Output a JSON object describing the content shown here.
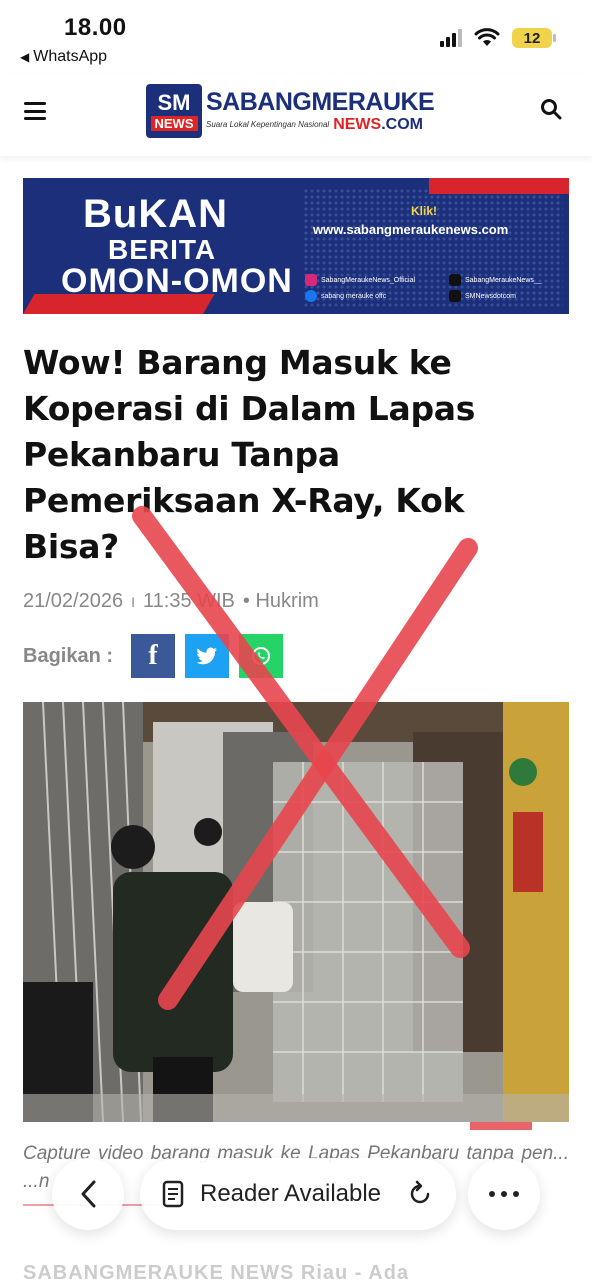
{
  "status_bar": {
    "time": "18.00",
    "back_app": "WhatsApp",
    "battery": "12"
  },
  "header": {
    "logo": {
      "badge_top": "SM",
      "badge_bottom": "NEWS",
      "name": "SABANGMERAUKE",
      "tagline": "Suara Lokal Kepentingan Nasional",
      "domain_part1": "NEWS",
      "domain_part2": ".COM"
    },
    "menu_icon": "hamburger-icon",
    "search_icon": "search-icon"
  },
  "banner": {
    "line1": "BuKAN",
    "line2": "BERITA",
    "line3": "OMON-OMON",
    "klik": "Klik!",
    "url": "www.sabangmeraukenews.com",
    "instagram": "SabangMeraukeNews_Official",
    "tiktok": "SabangMeraukeNews__",
    "facebook": "sabang merauke offc",
    "x": "SMNewsdotcom"
  },
  "article": {
    "headline": "Wow! Barang Masuk ke Koperasi di Dalam Lapas Pekanbaru Tanpa Pemeriksaan X-Ray, Kok Bisa?",
    "date": "21/02/2026",
    "separator": "I",
    "time": "11:35 WIB",
    "category": "• Hukrim",
    "share_label": "Bagikan :",
    "share_buttons": [
      "f",
      "t",
      "w"
    ],
    "caption": "Capture video barang masuk ke Lapas Pekanbaru tanpa pen... ...n",
    "body_start": "SABANGMERAUKE NEWS Riau - Ada"
  },
  "toolbar": {
    "reader_label": "Reader Available",
    "back_icon": "chevron-left-icon",
    "reader_icon": "reader-icon",
    "reload_icon": "reload-icon",
    "more_icon": "more-icon"
  },
  "colors": {
    "brand_blue": "#1b2f7a",
    "brand_red": "#e02424",
    "overlay_x": "#e8464e"
  }
}
